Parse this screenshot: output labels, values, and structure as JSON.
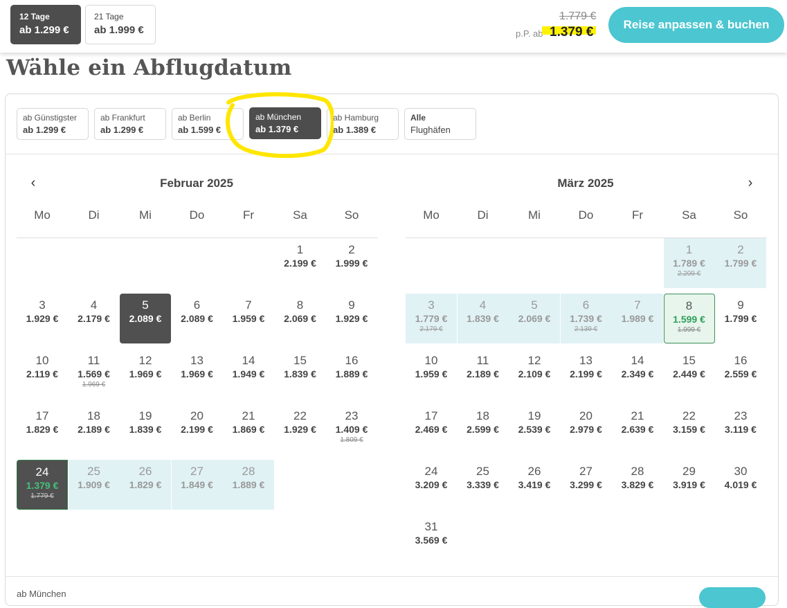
{
  "durations": [
    {
      "days": "12 Tage",
      "price": "ab 1.299 €",
      "active": true
    },
    {
      "days": "21 Tage",
      "price": "ab 1.999 €",
      "active": false
    }
  ],
  "summary": {
    "old_price": "1.779 €",
    "pp_label": "p.P. ab",
    "new_price": "1.379 €",
    "book_label": "Reise anpassen & buchen"
  },
  "page_title": "Wähle ein Abflugdatum",
  "airports": [
    {
      "name": "ab Günstigster",
      "price": "ab 1.299 €"
    },
    {
      "name": "ab Frankfurt",
      "price": "ab 1.299 €"
    },
    {
      "name": "ab Berlin",
      "price": "ab 1.599 €"
    },
    {
      "name": "ab München",
      "price": "ab 1.379 €",
      "active": true
    },
    {
      "name": "ab Hamburg",
      "price": "ab 1.389 €"
    },
    {
      "name": "Alle",
      "price": "Flughäfen"
    }
  ],
  "nav": {
    "prev": "‹",
    "next": "›"
  },
  "weekdays": [
    "Mo",
    "Di",
    "Mi",
    "Do",
    "Fr",
    "Sa",
    "So"
  ],
  "months": [
    {
      "title": "Februar 2025",
      "days": [
        {
          "d": "1",
          "p": "2.199 €",
          "col": 5,
          "row": 0
        },
        {
          "d": "2",
          "p": "1.999 €",
          "col": 6,
          "row": 0
        },
        {
          "d": "3",
          "p": "1.929 €",
          "col": 0,
          "row": 1
        },
        {
          "d": "4",
          "p": "2.179 €",
          "col": 1,
          "row": 1
        },
        {
          "d": "5",
          "p": "2.089 €",
          "col": 2,
          "row": 1,
          "state": "sel"
        },
        {
          "d": "6",
          "p": "2.089 €",
          "col": 3,
          "row": 1
        },
        {
          "d": "7",
          "p": "1.959 €",
          "col": 4,
          "row": 1
        },
        {
          "d": "8",
          "p": "2.069 €",
          "col": 5,
          "row": 1
        },
        {
          "d": "9",
          "p": "1.929 €",
          "col": 6,
          "row": 1
        },
        {
          "d": "10",
          "p": "2.119 €",
          "col": 0,
          "row": 2
        },
        {
          "d": "11",
          "p": "1.569 €",
          "old": "1.969 €",
          "col": 1,
          "row": 2
        },
        {
          "d": "12",
          "p": "1.969 €",
          "col": 2,
          "row": 2
        },
        {
          "d": "13",
          "p": "1.969 €",
          "col": 3,
          "row": 2
        },
        {
          "d": "14",
          "p": "1.949 €",
          "col": 4,
          "row": 2
        },
        {
          "d": "15",
          "p": "1.839 €",
          "col": 5,
          "row": 2
        },
        {
          "d": "16",
          "p": "1.889 €",
          "col": 6,
          "row": 2
        },
        {
          "d": "17",
          "p": "1.829 €",
          "col": 0,
          "row": 3
        },
        {
          "d": "18",
          "p": "2.189 €",
          "col": 1,
          "row": 3
        },
        {
          "d": "19",
          "p": "1.839 €",
          "col": 2,
          "row": 3
        },
        {
          "d": "20",
          "p": "2.199 €",
          "col": 3,
          "row": 3
        },
        {
          "d": "21",
          "p": "1.869 €",
          "col": 4,
          "row": 3
        },
        {
          "d": "22",
          "p": "1.929 €",
          "col": 5,
          "row": 3
        },
        {
          "d": "23",
          "p": "1.409 €",
          "old": "1.809 €",
          "col": 6,
          "row": 3
        },
        {
          "d": "24",
          "p": "1.379 €",
          "old": "1.779 €",
          "col": 0,
          "row": 4,
          "state": "start"
        },
        {
          "d": "25",
          "p": "1.909 €",
          "col": 1,
          "row": 4,
          "state": "range"
        },
        {
          "d": "26",
          "p": "1.829 €",
          "col": 2,
          "row": 4,
          "state": "range"
        },
        {
          "d": "27",
          "p": "1.849 €",
          "col": 3,
          "row": 4,
          "state": "range"
        },
        {
          "d": "28",
          "p": "1.889 €",
          "col": 4,
          "row": 4,
          "state": "range"
        }
      ]
    },
    {
      "title": "März 2025",
      "days": [
        {
          "d": "1",
          "p": "1.789 €",
          "old": "2.209 €",
          "col": 5,
          "row": 0,
          "state": "range"
        },
        {
          "d": "2",
          "p": "1.799 €",
          "col": 6,
          "row": 0,
          "state": "range"
        },
        {
          "d": "3",
          "p": "1.779 €",
          "old": "2.179 €",
          "col": 0,
          "row": 1,
          "state": "range"
        },
        {
          "d": "4",
          "p": "1.839 €",
          "col": 1,
          "row": 1,
          "state": "range"
        },
        {
          "d": "5",
          "p": "2.069 €",
          "col": 2,
          "row": 1,
          "state": "range"
        },
        {
          "d": "6",
          "p": "1.739 €",
          "old": "2.139 €",
          "col": 3,
          "row": 1,
          "state": "range"
        },
        {
          "d": "7",
          "p": "1.989 €",
          "col": 4,
          "row": 1,
          "state": "range"
        },
        {
          "d": "8",
          "p": "1.599 €",
          "old": "1.999 €",
          "col": 5,
          "row": 1,
          "state": "bestlight"
        },
        {
          "d": "9",
          "p": "1.799 €",
          "col": 6,
          "row": 1
        },
        {
          "d": "10",
          "p": "1.959 €",
          "col": 0,
          "row": 2
        },
        {
          "d": "11",
          "p": "2.189 €",
          "col": 1,
          "row": 2
        },
        {
          "d": "12",
          "p": "2.109 €",
          "col": 2,
          "row": 2
        },
        {
          "d": "13",
          "p": "2.199 €",
          "col": 3,
          "row": 2
        },
        {
          "d": "14",
          "p": "2.349 €",
          "col": 4,
          "row": 2
        },
        {
          "d": "15",
          "p": "2.449 €",
          "col": 5,
          "row": 2
        },
        {
          "d": "16",
          "p": "2.559 €",
          "col": 6,
          "row": 2
        },
        {
          "d": "17",
          "p": "2.469 €",
          "col": 0,
          "row": 3
        },
        {
          "d": "18",
          "p": "2.599 €",
          "col": 1,
          "row": 3
        },
        {
          "d": "19",
          "p": "2.539 €",
          "col": 2,
          "row": 3
        },
        {
          "d": "20",
          "p": "2.979 €",
          "col": 3,
          "row": 3
        },
        {
          "d": "21",
          "p": "2.639 €",
          "col": 4,
          "row": 3
        },
        {
          "d": "22",
          "p": "3.159 €",
          "col": 5,
          "row": 3
        },
        {
          "d": "23",
          "p": "3.119 €",
          "col": 6,
          "row": 3
        },
        {
          "d": "24",
          "p": "3.209 €",
          "col": 0,
          "row": 4
        },
        {
          "d": "25",
          "p": "3.339 €",
          "col": 1,
          "row": 4
        },
        {
          "d": "26",
          "p": "3.419 €",
          "col": 2,
          "row": 4
        },
        {
          "d": "27",
          "p": "3.299 €",
          "col": 3,
          "row": 4
        },
        {
          "d": "28",
          "p": "3.829 €",
          "col": 4,
          "row": 4
        },
        {
          "d": "29",
          "p": "3.919 €",
          "col": 5,
          "row": 4
        },
        {
          "d": "30",
          "p": "4.019 €",
          "col": 6,
          "row": 4
        },
        {
          "d": "31",
          "p": "3.569 €",
          "col": 0,
          "row": 5
        }
      ]
    }
  ],
  "footer": {
    "label": "ab München"
  },
  "colors": {
    "accent": "#4cc6d0",
    "dark": "#4d4d4d",
    "range": "#e1f2f5",
    "best": "#2f9e5a",
    "highlight": "#fff200"
  }
}
